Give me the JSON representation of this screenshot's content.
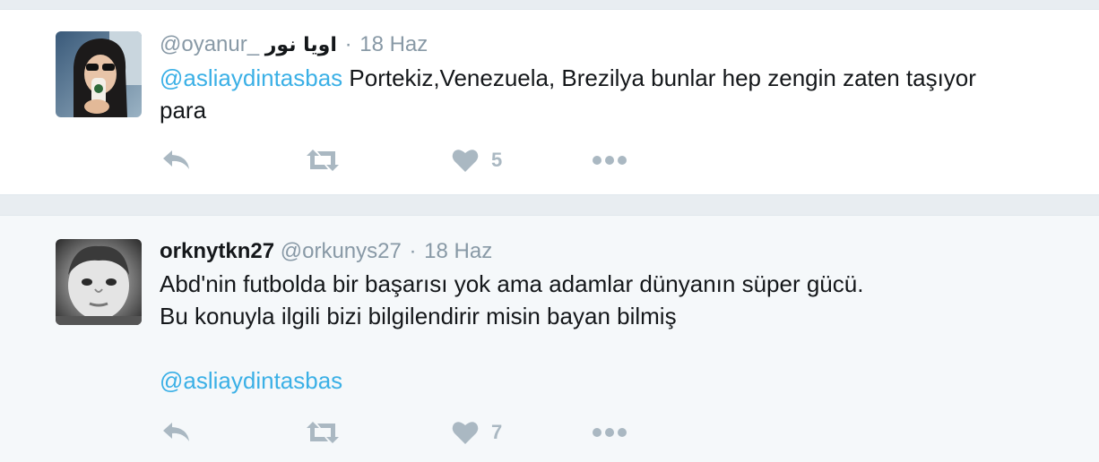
{
  "tweets": [
    {
      "handle": "@oyanur_",
      "display_name_rtl": "اويا نور",
      "separator": "·",
      "time": "18 Haz",
      "mention": "@asliaydintasbas",
      "text_line1": " Portekiz,Venezuela, Brezilya bunlar hep zengin zaten taşıyor",
      "text_line2": "para",
      "like_count": "5",
      "avatar": "woman-with-sunglasses-photo"
    },
    {
      "fullname": "orknytkn27",
      "handle": "@orkunys27",
      "separator": "·",
      "time": "18 Haz",
      "text_line1": "Abd'nin futbolda bir başarısı yok ama adamlar dünyanın süper gücü.",
      "text_line2": "Bu konuyla ilgili bizi bilgilendirir misin bayan bilmiş",
      "mention": "@asliaydintasbas",
      "like_count": "7",
      "avatar": "child-face-photo"
    }
  ],
  "colors": {
    "mention": "#3bb0e6",
    "icon": "#aab8c2",
    "text": "#14171a",
    "meta": "#8899a6"
  },
  "icons": [
    "reply-icon",
    "retweet-icon",
    "heart-icon",
    "more-icon"
  ]
}
